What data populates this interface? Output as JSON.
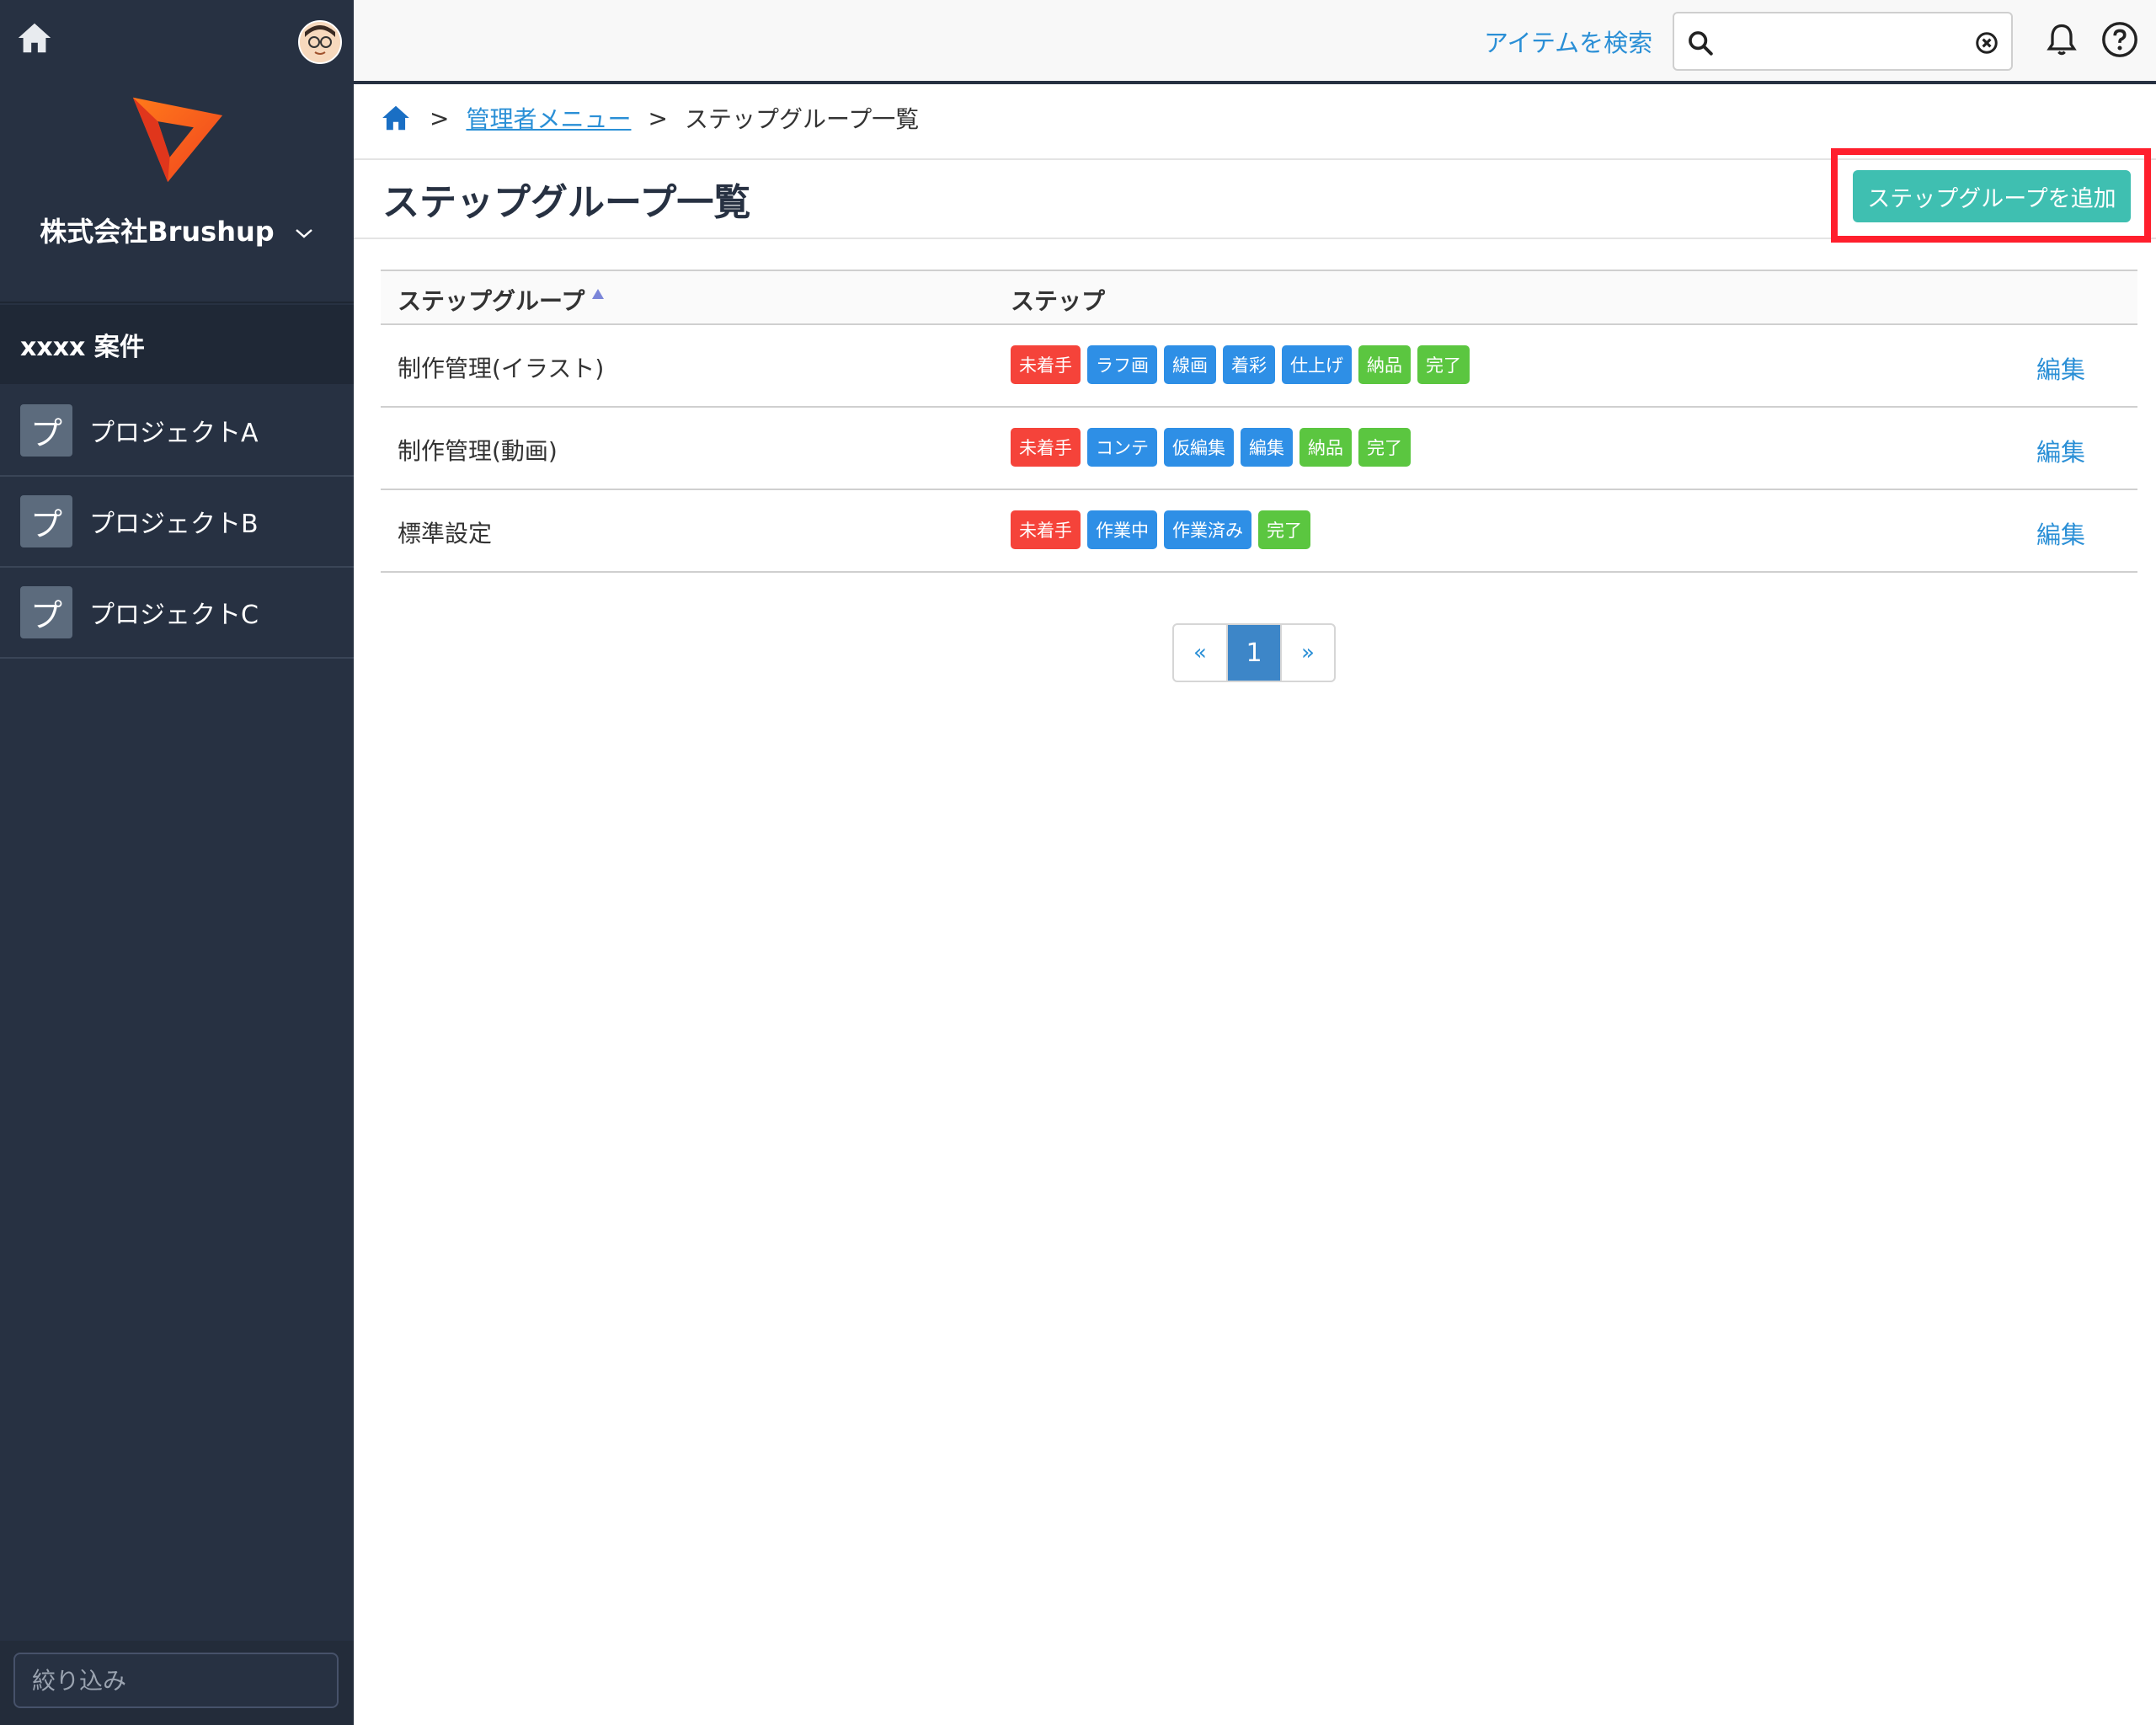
{
  "sidebar": {
    "org_name": "株式会社Brushup",
    "case_label": "xxxx 案件",
    "projects": [
      {
        "badge": "プ",
        "label": "プロジェクトA"
      },
      {
        "badge": "プ",
        "label": "プロジェクトB"
      },
      {
        "badge": "プ",
        "label": "プロジェクトC"
      }
    ],
    "filter_placeholder": "絞り込み"
  },
  "header": {
    "search_link": "アイテムを検索",
    "search_value": ""
  },
  "breadcrumb": {
    "sep": ">",
    "admin_menu": "管理者メニュー",
    "current": "ステップグループ一覧"
  },
  "main": {
    "title": "ステップグループ一覧",
    "add_button": "ステップグループを追加"
  },
  "table": {
    "col_group": "ステップグループ",
    "col_steps": "ステップ",
    "edit_label": "編集",
    "rows": [
      {
        "name": "制作管理(イラスト)",
        "steps": [
          {
            "label": "未着手",
            "color": "#f5433a"
          },
          {
            "label": "ラフ画",
            "color": "#2e8fe6"
          },
          {
            "label": "線画",
            "color": "#2e8fe6"
          },
          {
            "label": "着彩",
            "color": "#2e8fe6"
          },
          {
            "label": "仕上げ",
            "color": "#2e8fe6"
          },
          {
            "label": "納品",
            "color": "#5bc640"
          },
          {
            "label": "完了",
            "color": "#5bc640"
          }
        ]
      },
      {
        "name": "制作管理(動画)",
        "steps": [
          {
            "label": "未着手",
            "color": "#f5433a"
          },
          {
            "label": "コンテ",
            "color": "#2e8fe6"
          },
          {
            "label": "仮編集",
            "color": "#2e8fe6"
          },
          {
            "label": "編集",
            "color": "#2e8fe6"
          },
          {
            "label": "納品",
            "color": "#5bc640"
          },
          {
            "label": "完了",
            "color": "#5bc640"
          }
        ]
      },
      {
        "name": "標準設定",
        "steps": [
          {
            "label": "未着手",
            "color": "#f5433a"
          },
          {
            "label": "作業中",
            "color": "#2e8fe6"
          },
          {
            "label": "作業済み",
            "color": "#2e8fe6"
          },
          {
            "label": "完了",
            "color": "#5bc640"
          }
        ]
      }
    ]
  },
  "pagination": {
    "prev": "«",
    "current": "1",
    "next": "»"
  },
  "colors": {
    "sidebar_bg": "#273142",
    "accent_teal": "#3fbfb1",
    "link_blue": "#2a8fd6",
    "highlight_red": "#ff1f2d"
  }
}
